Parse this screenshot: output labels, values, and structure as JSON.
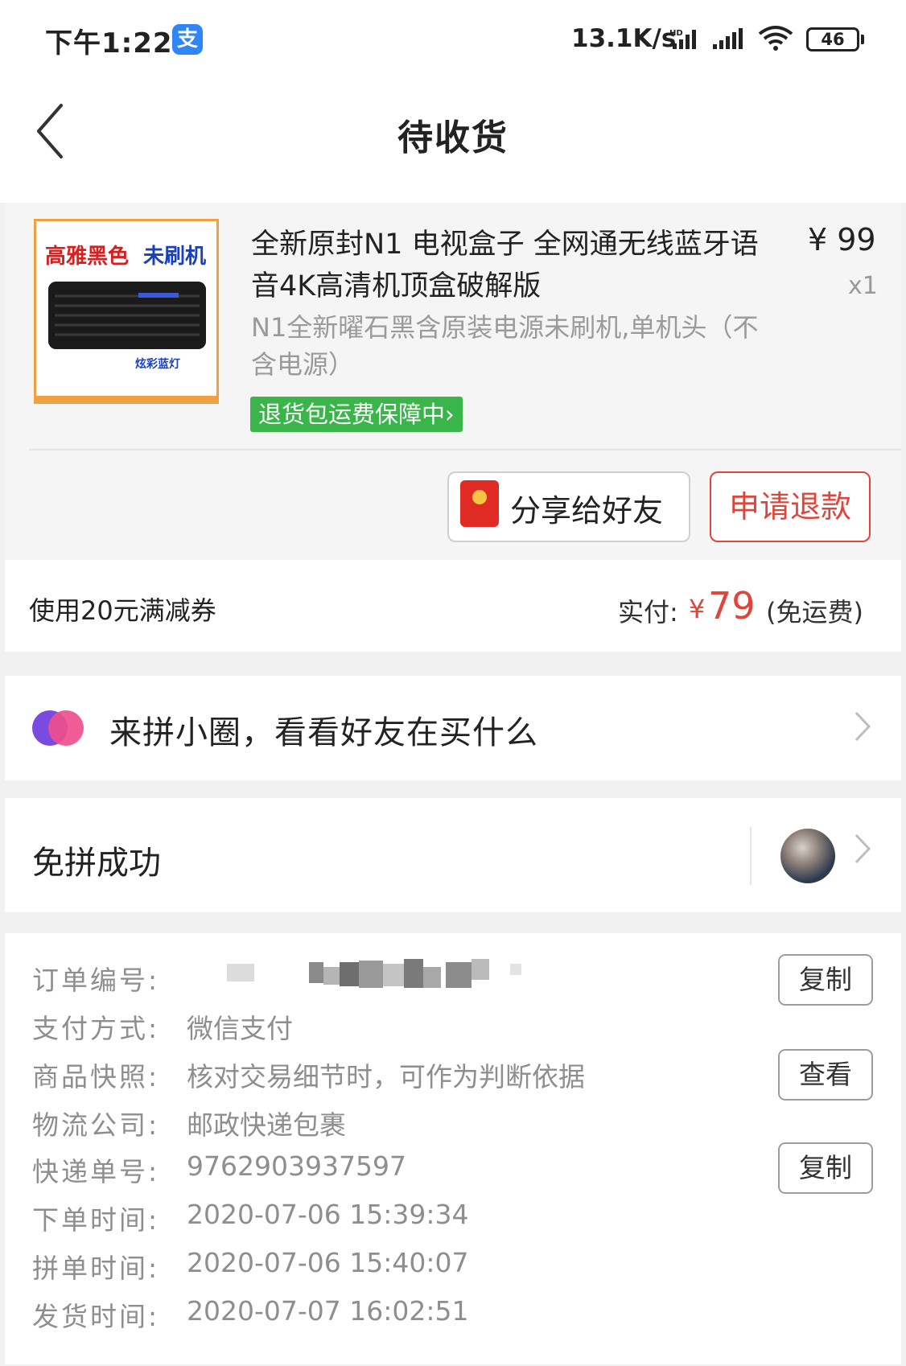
{
  "status_bar": {
    "time": "下午1:22",
    "alipay_glyph": "支",
    "net_speed": "13.1K/s",
    "battery": "46",
    "icons": [
      "alipay-icon",
      "hd-signal-icon",
      "signal-icon",
      "wifi-icon",
      "battery-icon"
    ]
  },
  "nav": {
    "title": "待收货",
    "back_icon": "chevron-left-icon"
  },
  "product": {
    "image_text_1": "高雅黑色",
    "image_text_2": "未刷机",
    "image_text_3": "炫彩蓝灯",
    "title": "全新原封N1 电视盒子 全网通无线蓝牙语音4K高清机顶盒破解版",
    "spec": "N1全新曜石黑含原装电源未刷机,单机头（不含电源）",
    "price": "¥ 99",
    "quantity": "x1",
    "guarantee": "退货包运费保障中",
    "guarantee_arrow": "›"
  },
  "actions": {
    "share": "分享给好友",
    "refund": "申请退款"
  },
  "payment": {
    "coupon": "使用20元满减券",
    "paid_label": "实付:",
    "currency": "¥",
    "amount": "79",
    "note": "(免运费)"
  },
  "circle": {
    "text": "来拼小圈，看看好友在买什么"
  },
  "group": {
    "status": "免拼成功"
  },
  "order_info": {
    "order_no_label": "订单编号:",
    "order_no_value": "",
    "pay_method_label": "支付方式:",
    "pay_method_value": "微信支付",
    "snapshot_label": "商品快照:",
    "snapshot_value": "核对交易细节时，可作为判断依据",
    "logistics_label": "物流公司:",
    "logistics_value": "邮政快递包裹",
    "tracking_label": "快递单号:",
    "tracking_value": "9762903937597",
    "order_time_label": "下单时间:",
    "order_time_value": "2020-07-06 15:39:34",
    "group_time_label": "拼单时间:",
    "group_time_value": "2020-07-06 15:40:07",
    "ship_time_label": "发货时间:",
    "ship_time_value": "2020-07-07 16:02:51",
    "copy_label": "复制",
    "view_label": "查看"
  },
  "colors": {
    "accent_red": "#e0453b",
    "guarantee_green": "#39b54a",
    "circle_purple": "#7a4be0",
    "circle_pink": "#ef4e8c"
  }
}
